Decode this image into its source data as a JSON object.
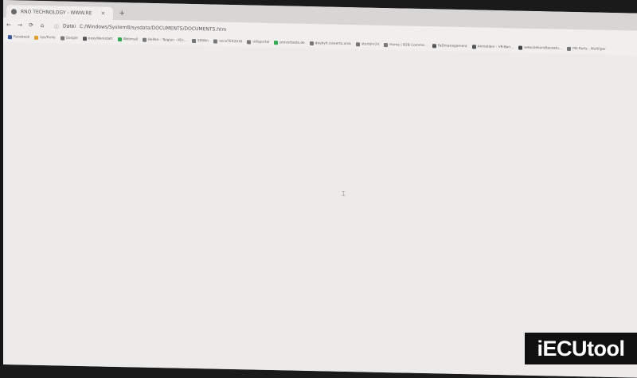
{
  "browser": {
    "tab": {
      "title": "RNO TECHNOLOGY - WWW.RE",
      "close": "×"
    },
    "new_tab": "+",
    "nav": {
      "back": "←",
      "forward": "→",
      "reload": "⟳",
      "home": "⌂"
    },
    "address": {
      "scheme_label": "Datei",
      "url": "C:/Windows/System8/sysdata/DOCUMENTS/DOCUMENTS.htm"
    }
  },
  "bookmarks": [
    {
      "label": "Facebook",
      "color": "#3b5998"
    },
    {
      "label": "sys/frolio",
      "color": "#e0a030"
    },
    {
      "label": "Google",
      "color": "#777777"
    },
    {
      "label": "easyWerkstatt",
      "color": "#555555"
    },
    {
      "label": "Webmail",
      "color": "#2fa84f"
    },
    {
      "label": "Reifen - Teiglen - Klic...",
      "color": "#777777"
    },
    {
      "label": "SDWin",
      "color": "#777777"
    },
    {
      "label": "vecoTEX2016",
      "color": "#777777"
    },
    {
      "label": "Infoportal",
      "color": "#777777"
    },
    {
      "label": "provorbeda.de",
      "color": "#2fa84f"
    },
    {
      "label": "daybyit.cowerto.orok",
      "color": "#777777"
    },
    {
      "label": "stertshr24",
      "color": "#777777"
    },
    {
      "label": "Home | B2B Comme...",
      "color": "#777777"
    },
    {
      "label": "FaDmanagement",
      "color": "#555555"
    },
    {
      "label": "Anmelden - VR-Ban...",
      "color": "#555555"
    },
    {
      "label": "www.bekundtausatu...",
      "color": "#444444"
    },
    {
      "label": "MS Parts - Multilper",
      "color": "#777777"
    }
  ],
  "watermark": {
    "text": "iECUtool"
  }
}
